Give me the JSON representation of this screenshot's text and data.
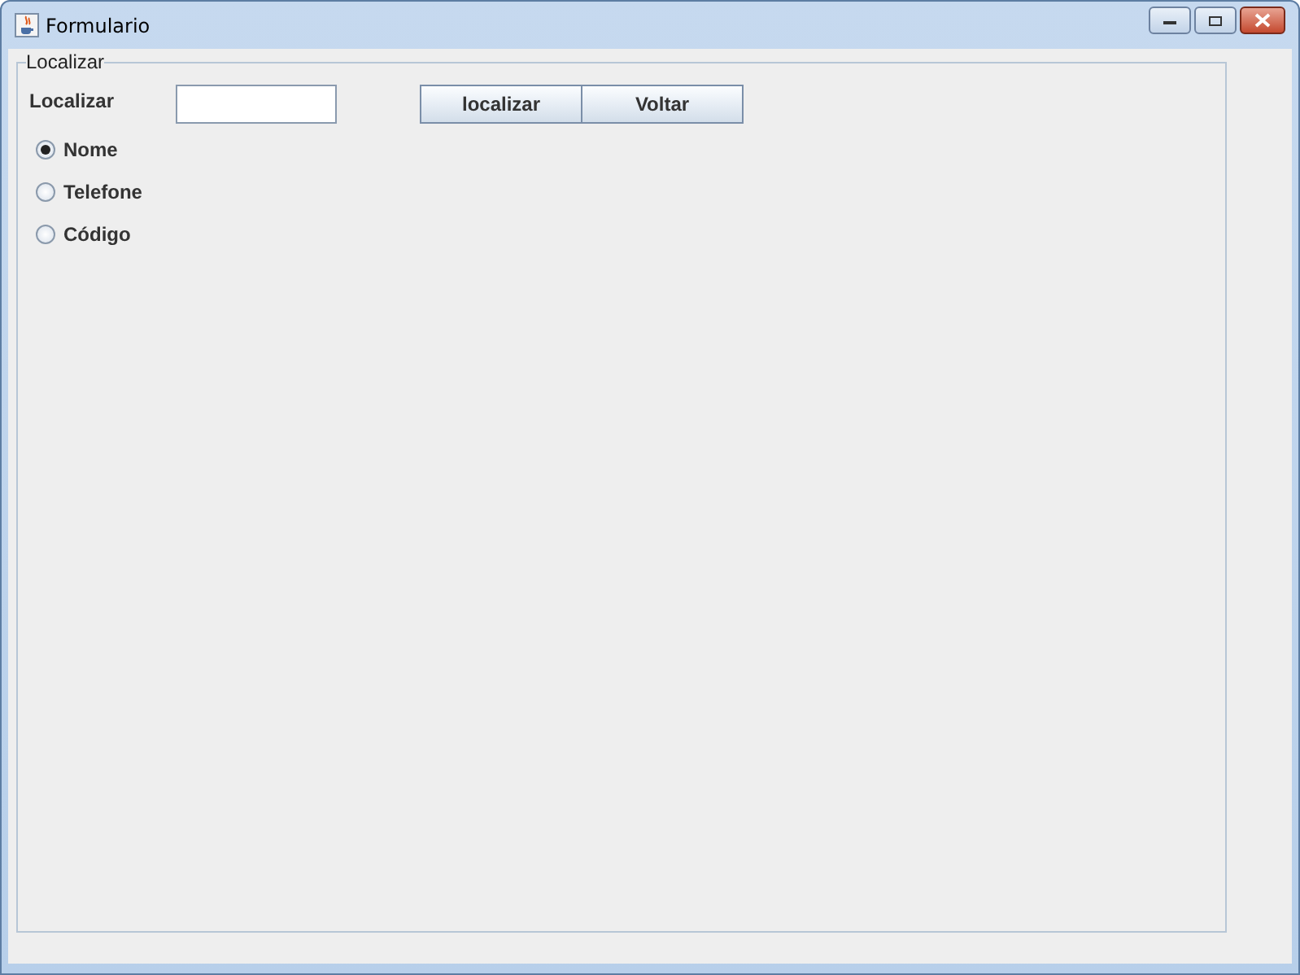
{
  "window": {
    "title": "Formulario"
  },
  "group": {
    "title": "Localizar"
  },
  "search": {
    "label": "Localizar"
  },
  "buttons": [
    "localizar",
    "Voltar"
  ],
  "options": [
    {
      "label": "Nome",
      "selected": true
    },
    {
      "label": "Telefone",
      "selected": false
    },
    {
      "label": "Código",
      "selected": false
    }
  ]
}
